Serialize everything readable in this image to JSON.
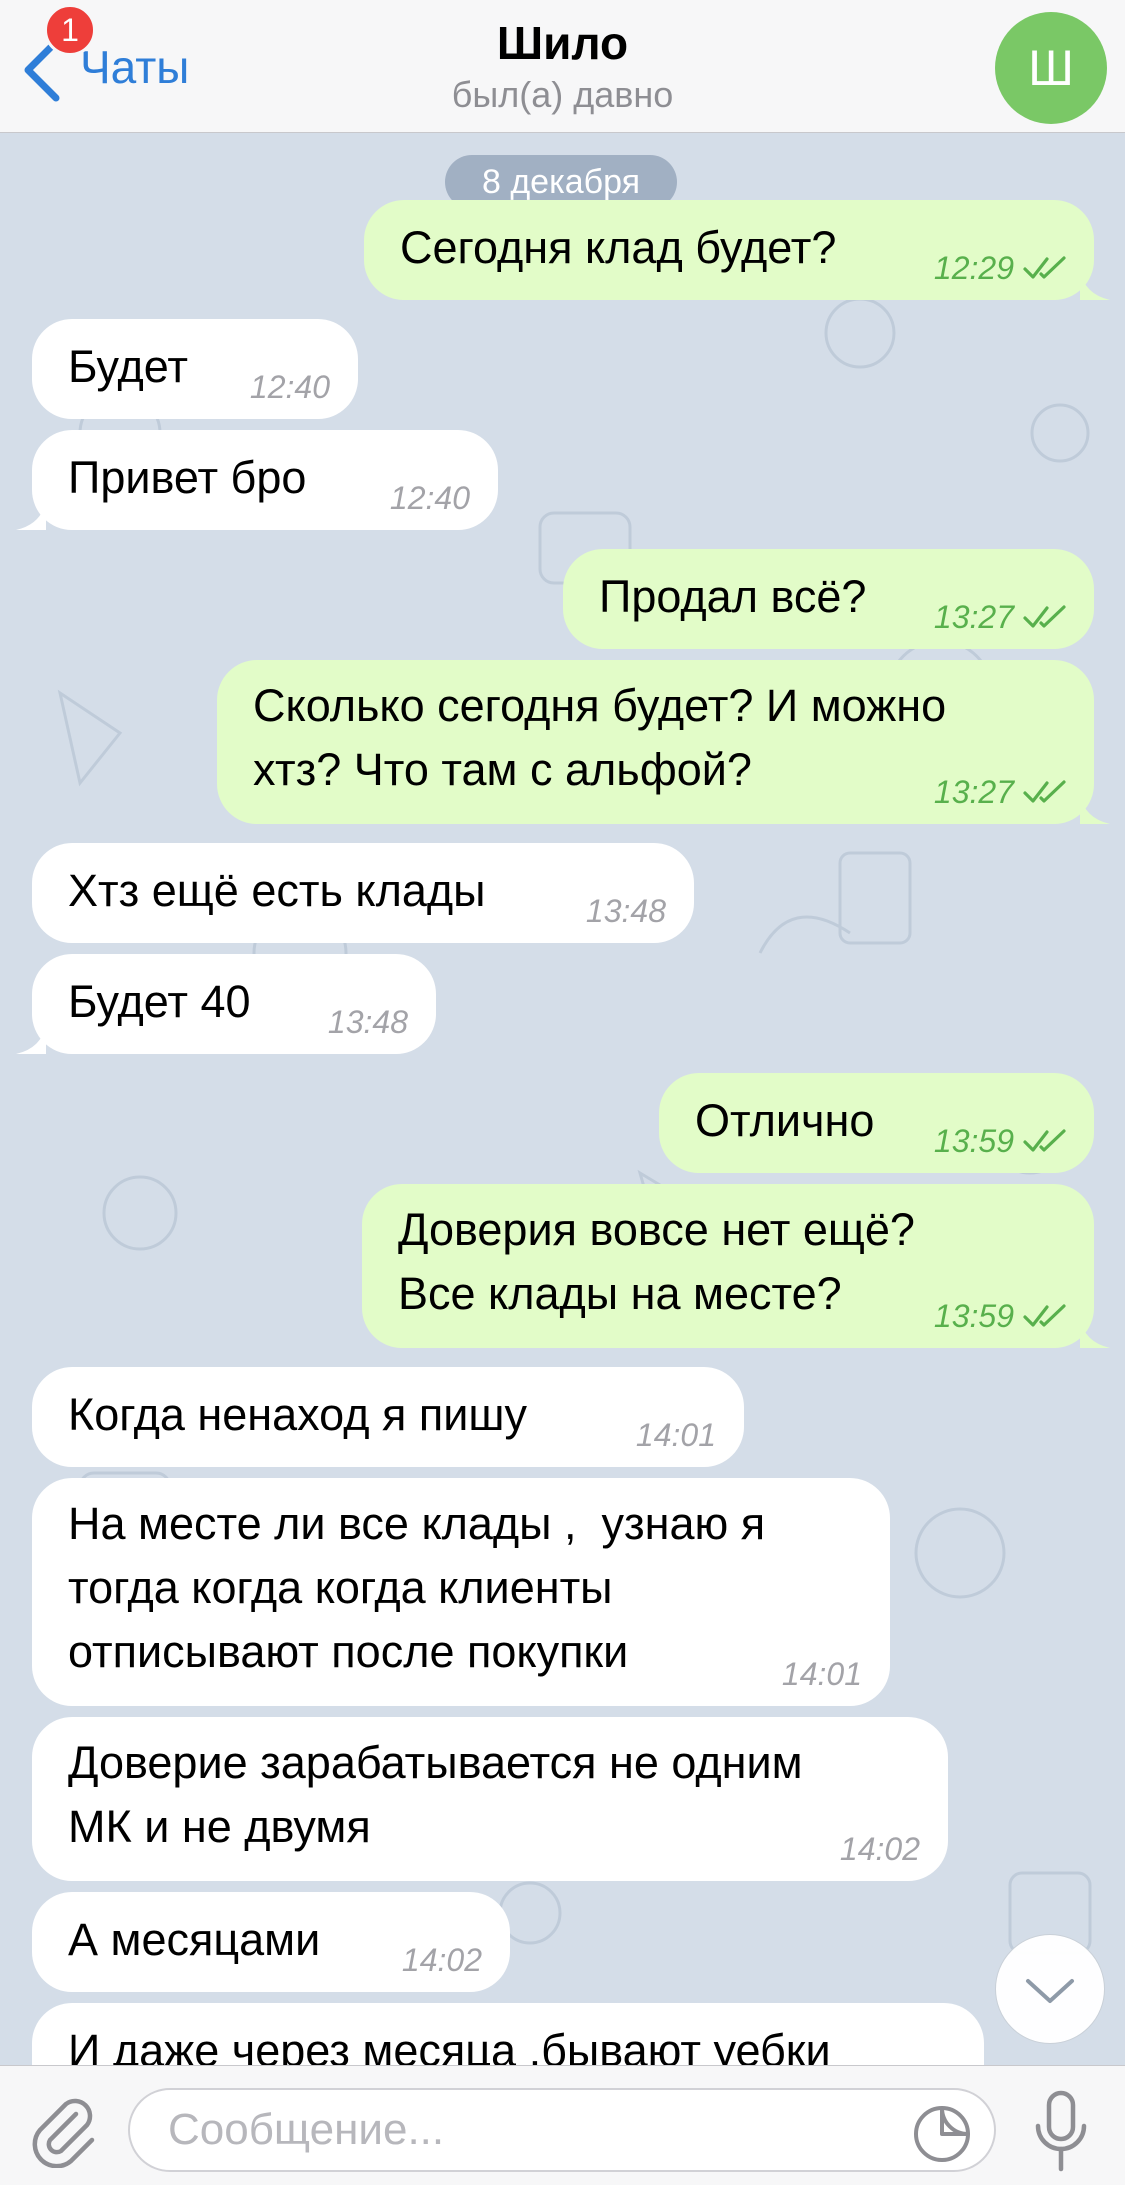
{
  "header": {
    "back_label": "Чаты",
    "unread_count": "1",
    "title": "Шило",
    "status": "был(а) давно",
    "avatar_letter": "Ш",
    "avatar_color": "#7ac866",
    "accent_color": "#2f7ed8"
  },
  "chat": {
    "date": "8 декабря",
    "messages": [
      {
        "side": "out",
        "lines": [
          "Сегодня клад будет?"
        ],
        "time": "12:29",
        "read": true
      },
      {
        "side": "in",
        "lines": [
          "Будет"
        ],
        "time": "12:40"
      },
      {
        "side": "in",
        "lines": [
          "Привет бро"
        ],
        "time": "12:40"
      },
      {
        "side": "out",
        "lines": [
          "Продал всё?"
        ],
        "time": "13:27",
        "read": true
      },
      {
        "side": "out",
        "lines": [
          "Сколько сегодня будет? И можно",
          "хтз? Что там с альфой?"
        ],
        "time": "13:27",
        "read": true
      },
      {
        "side": "in",
        "lines": [
          "Хтз ещё есть клады"
        ],
        "time": "13:48"
      },
      {
        "side": "in",
        "lines": [
          "Будет 40"
        ],
        "time": "13:48"
      },
      {
        "side": "out",
        "lines": [
          "Отлично"
        ],
        "time": "13:59",
        "read": true
      },
      {
        "side": "out",
        "lines": [
          "Доверия вовсе нет ещё?",
          "Все клады на месте?"
        ],
        "time": "13:59",
        "read": true
      },
      {
        "side": "in",
        "lines": [
          "Когда ненаход я пишу"
        ],
        "time": "14:01"
      },
      {
        "side": "in",
        "lines": [
          "На месте ли все клады ,  узнаю я",
          "тогда когда когда клиенты",
          "отписывают после покупки"
        ],
        "time": "14:01"
      },
      {
        "side": "in",
        "lines": [
          "Доверие зарабатывается не одним",
          "МК и не двумя"
        ],
        "time": "14:02"
      },
      {
        "side": "in",
        "lines": [
          "А месяцами"
        ],
        "time": "14:02"
      },
      {
        "side": "in",
        "lines": [
          "И даже через месяца ,бывают уебки"
        ],
        "time": ""
      }
    ],
    "incoming_bubble_color": "#ffffff",
    "outgoing_bubble_color": "#e2fcc8",
    "read_check_color": "#58b04c"
  },
  "input": {
    "placeholder": "Сообщение...",
    "value": ""
  },
  "icons": {
    "back": "chevron-left-icon",
    "attach": "paperclip-icon",
    "sticker": "sticker-icon",
    "mic": "microphone-icon",
    "scroll": "chevron-down-icon",
    "read": "double-check-icon"
  }
}
